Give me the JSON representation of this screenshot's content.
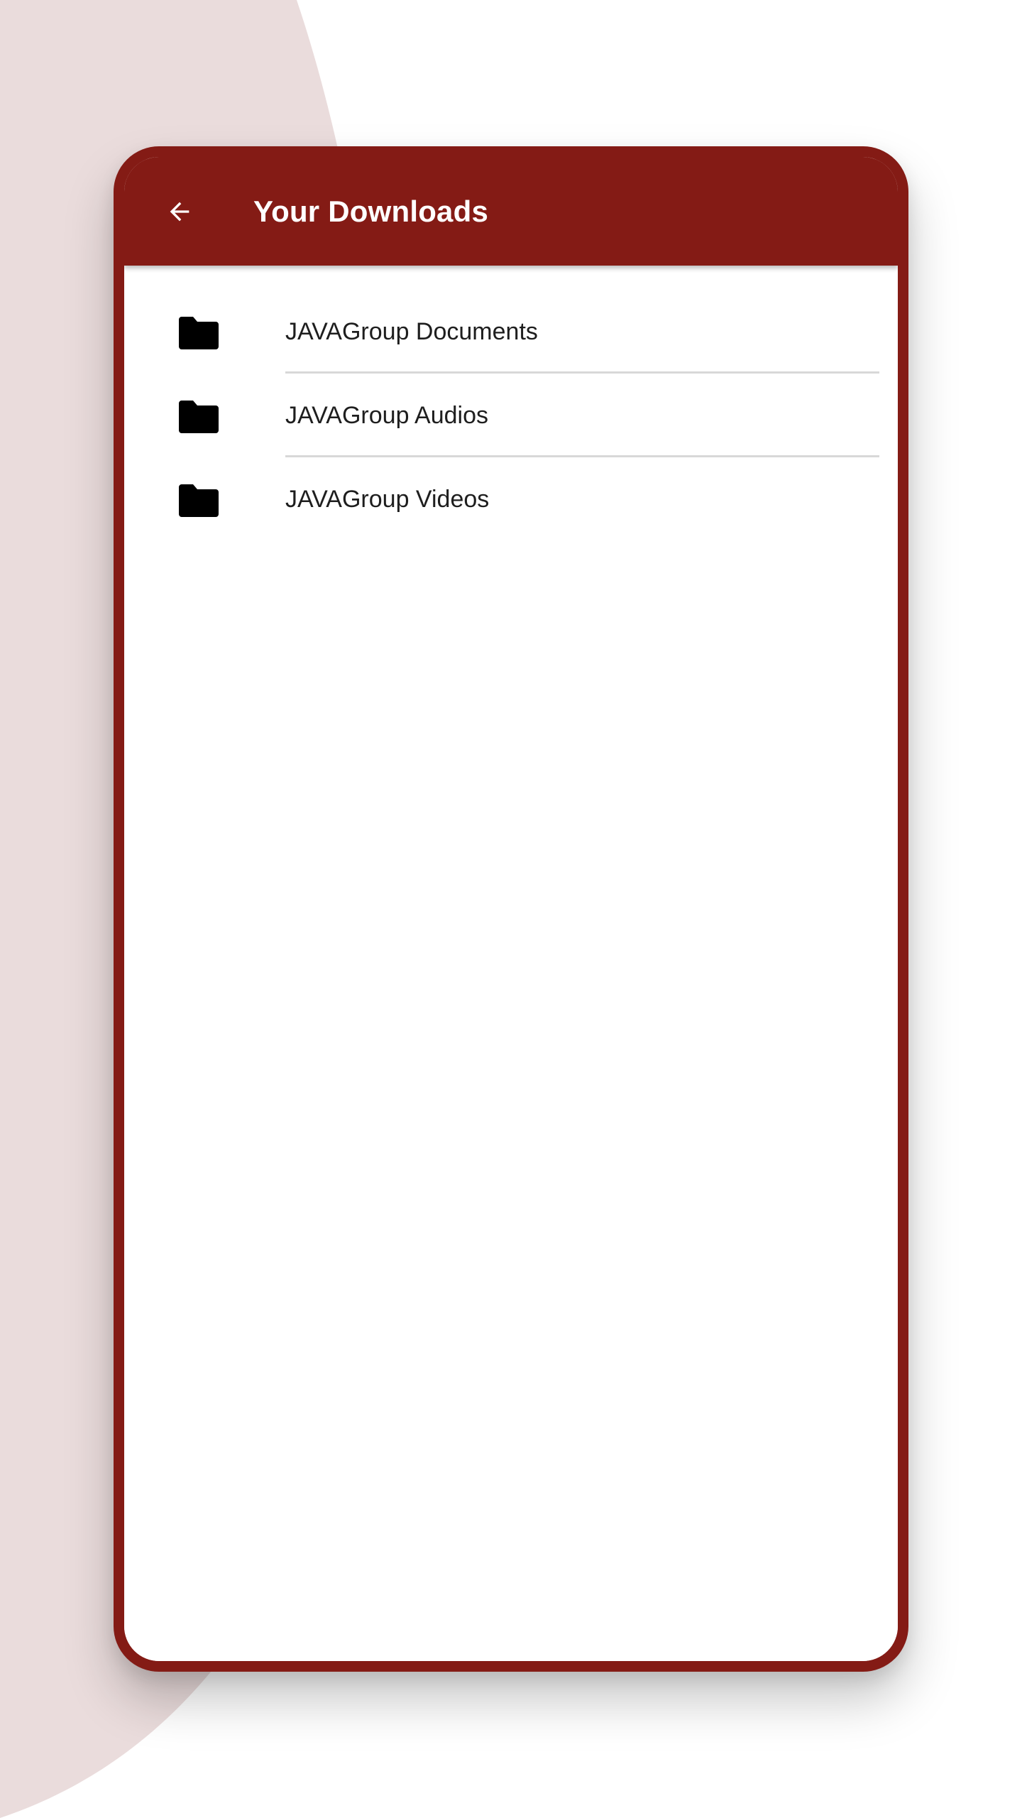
{
  "app_bar": {
    "title": "Your Downloads",
    "back_icon": "arrow-left-icon",
    "background_color": "#841b15",
    "text_color": "#ffffff"
  },
  "folders": [
    {
      "icon": "folder-icon",
      "label": "JAVAGroup Documents"
    },
    {
      "icon": "folder-icon",
      "label": "JAVAGroup Audios"
    },
    {
      "icon": "folder-icon",
      "label": "JAVAGroup Videos"
    }
  ],
  "colors": {
    "frame": "#841b15",
    "background_blob": "#eadcdc",
    "divider": "#d8d8d8"
  }
}
